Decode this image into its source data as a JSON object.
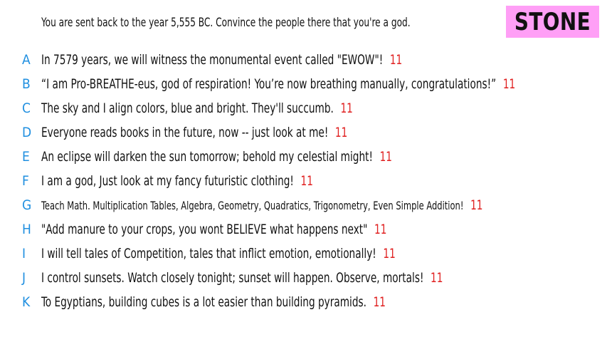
{
  "prompt": "You are sent back to the year 5,555 BC. Convince the people there that you're a god.",
  "badge": {
    "label": "STONE",
    "color": "#ff9ff6"
  },
  "colors": {
    "letter": "#1f8fe0",
    "count": "#e02020",
    "text": "#111111"
  },
  "options": [
    {
      "letter": "A",
      "text": "In 7579 years, we will witness the monumental event called \"EWOW\"!",
      "count": "11"
    },
    {
      "letter": "B",
      "text": "“I am Pro-BREATHE-eus, god of respiration! You’re now breathing manually, congratulations!”",
      "count": "11"
    },
    {
      "letter": "C",
      "text": "The sky and I align colors, blue and bright. They'll succumb.",
      "count": "11"
    },
    {
      "letter": "D",
      "text": "Everyone reads books in the future, now -- just look at me!",
      "count": "11"
    },
    {
      "letter": "E",
      "text": "An eclipse will darken the sun tomorrow; behold my celestial might!",
      "count": "11"
    },
    {
      "letter": "F",
      "text": "I am a god, Just look at my fancy futuristic clothing!",
      "count": "11"
    },
    {
      "letter": "G",
      "text": "Teach Math. Multiplication Tables, Algebra, Geometry, Quadratics, Trigonometry, Even Simple Addition!",
      "count": "11"
    },
    {
      "letter": "H",
      "text": "\"Add manure to your crops, you wont BELIEVE what happens next\"",
      "count": "11"
    },
    {
      "letter": "I",
      "text": "I will tell tales of Competition, tales that inflict emotion, emotionally!",
      "count": "11"
    },
    {
      "letter": "J",
      "text": "I control sunsets. Watch closely tonight; sunset will happen. Observe, mortals!",
      "count": "11"
    },
    {
      "letter": "K",
      "text": "To Egyptians, building cubes is a lot easier than building pyramids.",
      "count": "11"
    }
  ]
}
